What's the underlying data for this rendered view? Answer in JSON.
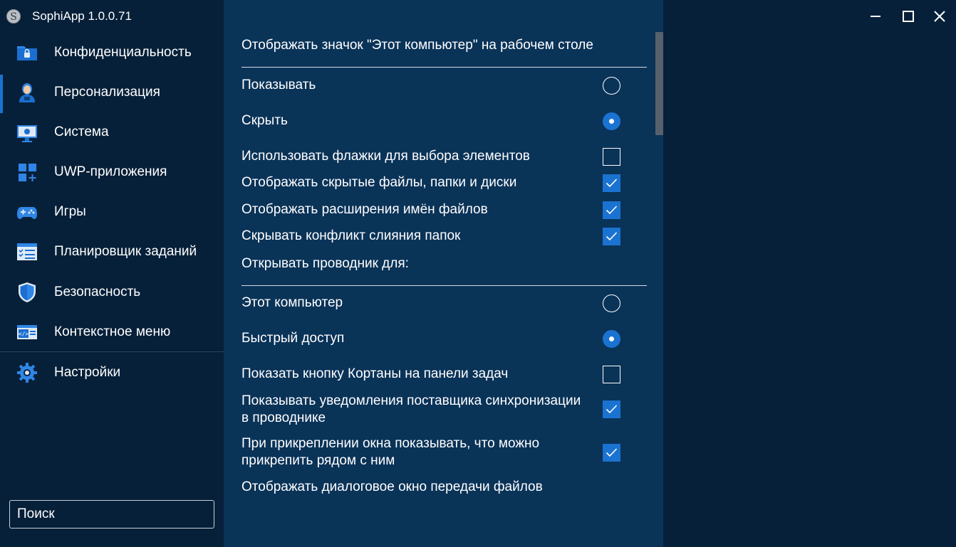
{
  "window": {
    "title": "SophiApp 1.0.0.71",
    "logo_letter": "S",
    "controls": [
      "minimize",
      "maximize",
      "close"
    ]
  },
  "sidebar": {
    "active_item": "Персонализация",
    "items": [
      {
        "label": "Конфиденциальность",
        "icon": "privacy-folder-lock-icon"
      },
      {
        "label": "Персонализация",
        "icon": "user-personalization-icon"
      },
      {
        "label": "Система",
        "icon": "monitor-system-icon"
      },
      {
        "label": "UWP-приложения",
        "icon": "uwp-apps-grid-icon"
      },
      {
        "label": "Игры",
        "icon": "gamepad-icon"
      },
      {
        "label": "Планировщик заданий",
        "icon": "task-scheduler-list-icon"
      },
      {
        "label": "Безопасность",
        "icon": "shield-icon"
      },
      {
        "label": "Контекстное меню",
        "icon": "context-menu-code-icon"
      },
      {
        "label": "Настройки",
        "icon": "gear-icon"
      }
    ],
    "search": {
      "placeholder": "Поиск",
      "value": ""
    }
  },
  "content": {
    "section1_title": "Отображать значок \"Этот компьютер\" на рабочем столе",
    "section1_options": [
      {
        "label": "Показывать",
        "type": "radio",
        "selected": false
      },
      {
        "label": "Скрыть",
        "type": "radio",
        "selected": true
      }
    ],
    "toggles1": [
      {
        "label": "Использовать флажки для выбора элементов",
        "checked": false
      },
      {
        "label": "Отображать скрытые файлы, папки и диски",
        "checked": true
      },
      {
        "label": "Отображать расширения имён файлов",
        "checked": true
      },
      {
        "label": "Скрывать конфликт слияния папок",
        "checked": true
      }
    ],
    "section2_title": "Открывать проводник для:",
    "section2_options": [
      {
        "label": "Этот компьютер",
        "type": "radio",
        "selected": false
      },
      {
        "label": "Быстрый доступ",
        "type": "radio",
        "selected": true
      }
    ],
    "toggles2": [
      {
        "label": "Показать кнопку Кортаны на панели задач",
        "checked": false
      },
      {
        "label": "Показывать уведомления поставщика синхронизации в проводнике",
        "checked": true
      },
      {
        "label": "При прикреплении окна показывать, что можно прикрепить рядом с ним",
        "checked": true
      }
    ],
    "last_item": "Отображать диалоговое окно передачи файлов"
  },
  "colors": {
    "sidebar_bg": "#072039",
    "content_bg": "#0a3358",
    "accent": "#1a73d1",
    "text": "#ffffff"
  }
}
